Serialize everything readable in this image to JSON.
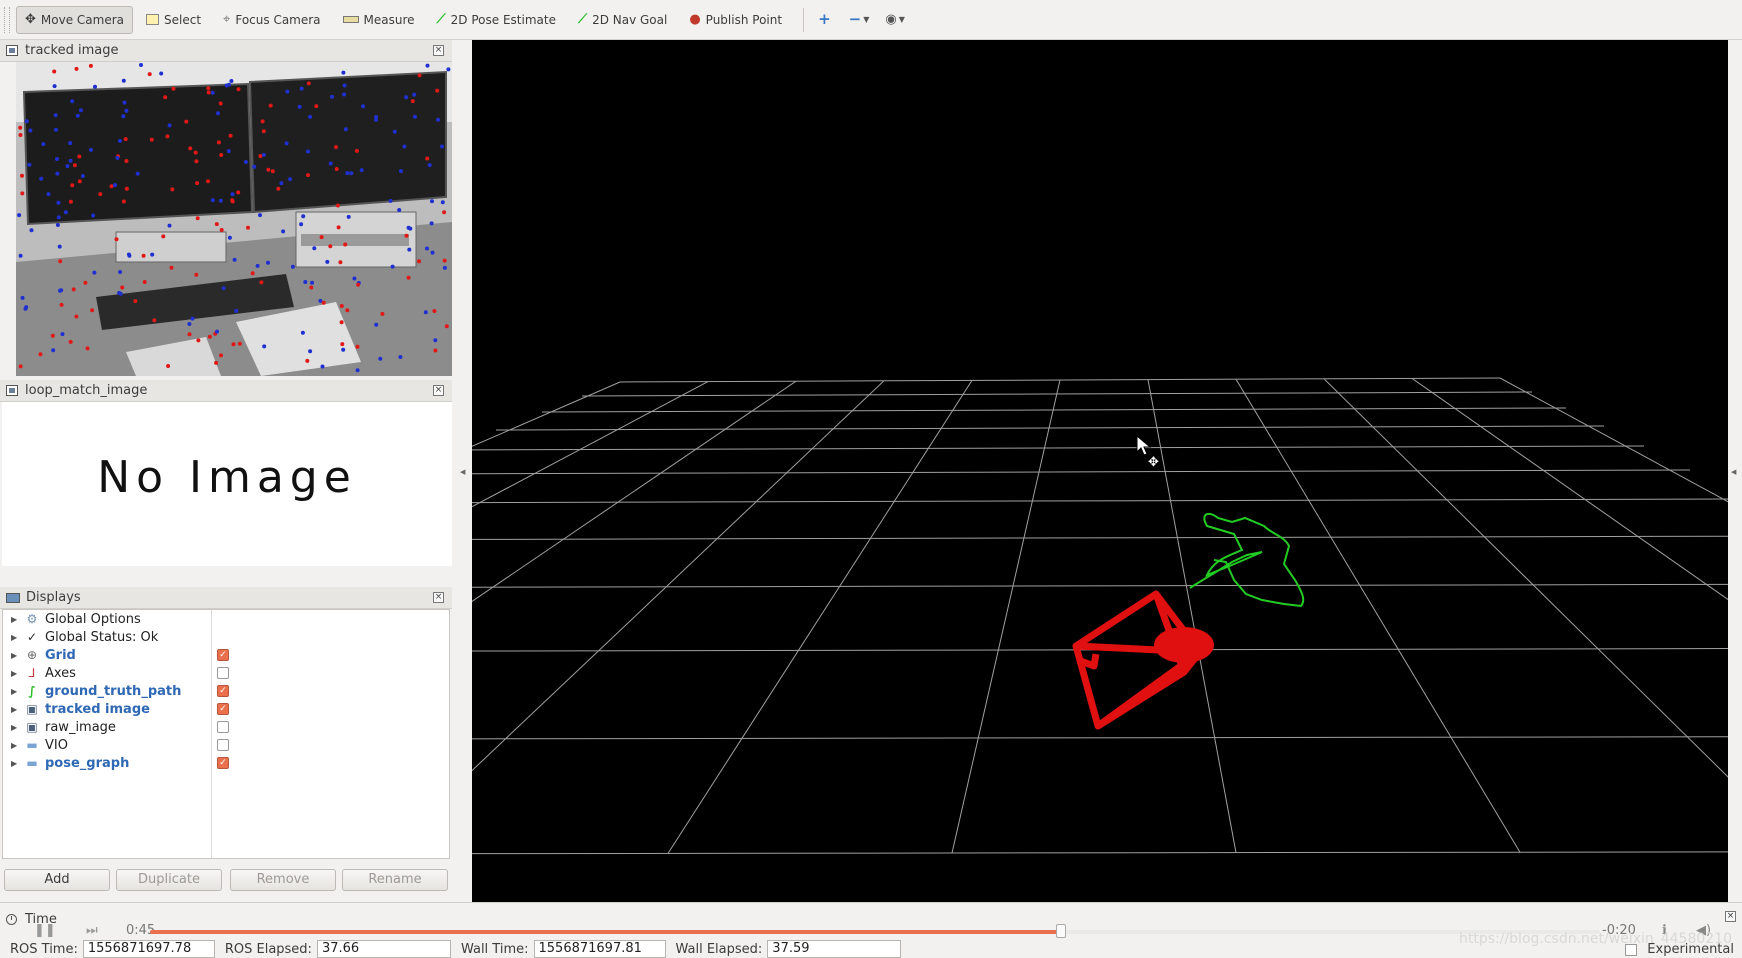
{
  "toolbar": {
    "tools": [
      {
        "label": "Move Camera",
        "icon": "move-camera-icon",
        "active": true
      },
      {
        "label": "Select",
        "icon": "select-icon"
      },
      {
        "label": "Focus Camera",
        "icon": "focus-camera-icon"
      },
      {
        "label": "Measure",
        "icon": "measure-icon"
      },
      {
        "label": "2D Pose Estimate",
        "icon": "pose-estimate-icon"
      },
      {
        "label": "2D Nav Goal",
        "icon": "nav-goal-icon"
      },
      {
        "label": "Publish Point",
        "icon": "publish-point-icon"
      }
    ]
  },
  "panels": {
    "tracked": {
      "title": "tracked image"
    },
    "loop": {
      "title": "loop_match_image",
      "no_image_text": "No Image"
    },
    "displays": {
      "title": "Displays",
      "items": [
        {
          "label": "Global Options",
          "icon": "gear-icon",
          "checkbox": null,
          "highlighted": false
        },
        {
          "label": "Global Status: Ok",
          "icon": "check-icon",
          "checkbox": null,
          "highlighted": false
        },
        {
          "label": "Grid",
          "icon": "grid-icon",
          "checkbox": true,
          "highlighted": true
        },
        {
          "label": "Axes",
          "icon": "axes-icon",
          "checkbox": false,
          "highlighted": false
        },
        {
          "label": "ground_truth_path",
          "icon": "path-icon",
          "checkbox": true,
          "highlighted": true
        },
        {
          "label": "tracked image",
          "icon": "image-icon",
          "checkbox": true,
          "highlighted": true
        },
        {
          "label": "raw_image",
          "icon": "image-icon",
          "checkbox": false,
          "highlighted": false
        },
        {
          "label": "VIO",
          "icon": "folder-icon",
          "checkbox": false,
          "highlighted": false
        },
        {
          "label": "pose_graph",
          "icon": "folder-icon",
          "checkbox": true,
          "highlighted": true
        }
      ],
      "buttons": {
        "add": "Add",
        "duplicate": "Duplicate",
        "remove": "Remove",
        "rename": "Rename"
      }
    }
  },
  "time": {
    "title": "Time",
    "playback_elapsed": "0:45",
    "playback_remaining": "-0:20",
    "progress": 0.628,
    "ros_time_label": "ROS Time:",
    "ros_time": "1556871697.78",
    "ros_elapsed_label": "ROS Elapsed:",
    "ros_elapsed": "37.66",
    "wall_time_label": "Wall Time:",
    "wall_time": "1556871697.81",
    "wall_elapsed_label": "Wall Elapsed:",
    "wall_elapsed": "37.59",
    "experimental_label": "Experimental",
    "watermark": "https://blog.csdn.net/weixin_44580210"
  },
  "colors": {
    "path": "#22cc22",
    "camera_frustum": "#e01010",
    "grid": "#a0a0a0",
    "checked": "#e8704c",
    "accent_text": "#2f68b4"
  }
}
